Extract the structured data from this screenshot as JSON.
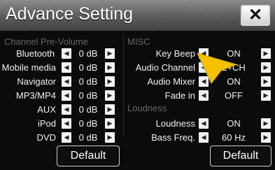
{
  "window": {
    "title": "Advance Setting",
    "close_label": "✕"
  },
  "left": {
    "section_title": "Channel Pre-Volume",
    "rows": [
      {
        "label": "Bluetooth",
        "value": "0 dB"
      },
      {
        "label": "Mobile media",
        "value": "0 dB"
      },
      {
        "label": "Navigator",
        "value": "0 dB"
      },
      {
        "label": "MP3/MP4",
        "value": "0 dB"
      },
      {
        "label": "AUX",
        "value": "0 dB"
      },
      {
        "label": "iPod",
        "value": "0 dB"
      },
      {
        "label": "DVD",
        "value": "0 dB"
      }
    ],
    "default_label": "Default"
  },
  "right": {
    "misc_title": "MISC",
    "misc_rows": [
      {
        "label": "Key Beep",
        "value": "ON"
      },
      {
        "label": "Audio Channel",
        "value": "L+CH"
      },
      {
        "label": "Audio Mixer",
        "value": "ON"
      },
      {
        "label": "Fade in",
        "value": "OFF"
      }
    ],
    "loudness_title": "Loudness",
    "loudness_rows": [
      {
        "label": "Loudness",
        "value": "ON"
      },
      {
        "label": "Bass Freq.",
        "value": "60 Hz"
      }
    ],
    "default_label": "Default"
  },
  "icons": {
    "left_arrow": "◀",
    "right_arrow": "▶"
  },
  "colors": {
    "pointer": "#f4c000"
  }
}
